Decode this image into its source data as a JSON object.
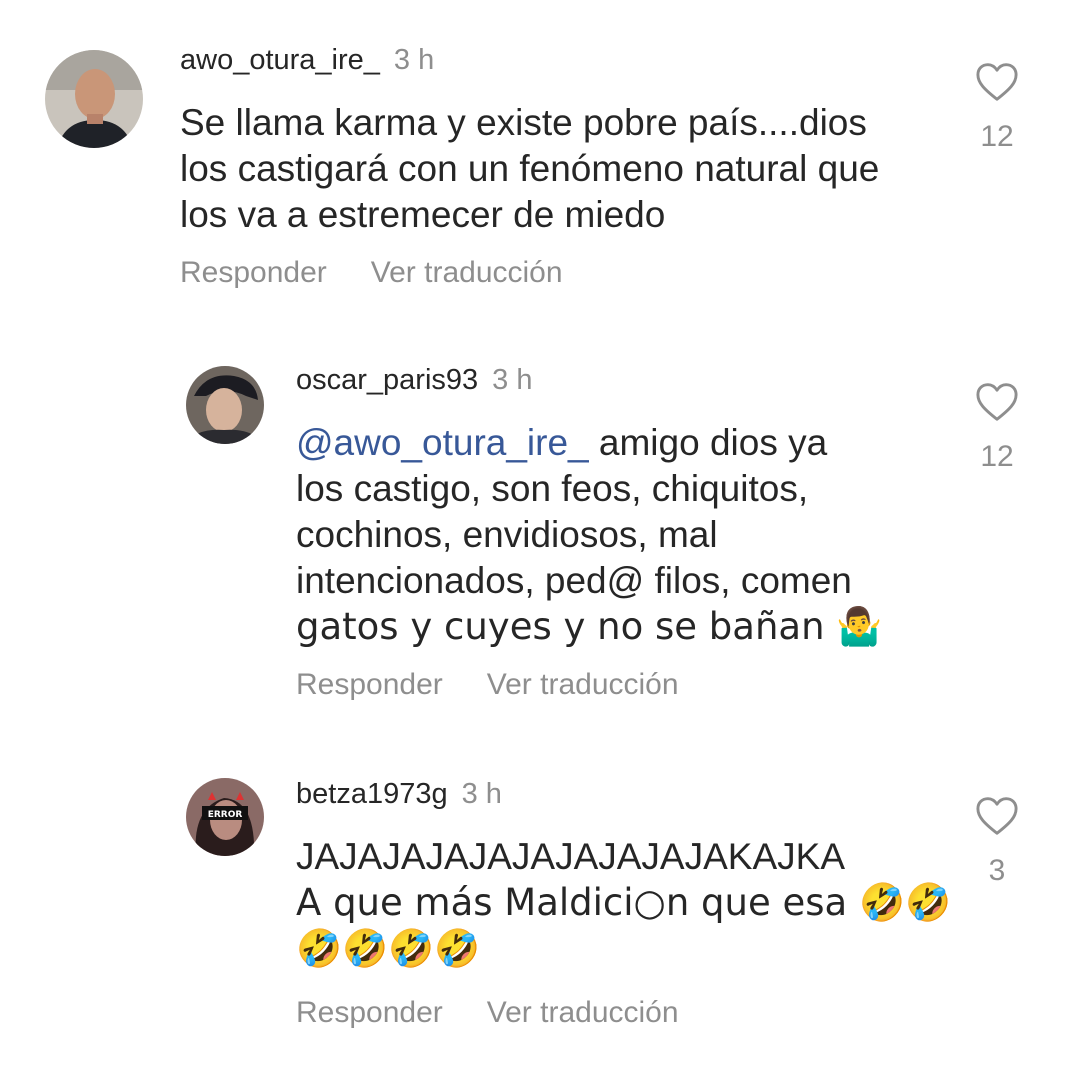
{
  "comments": [
    {
      "username": "awo_otura_ire_",
      "time": "3 h",
      "lines": [
        "Se llama karma y existe pobre país....dios",
        "los castigará con un fenómeno natural que",
        "los va a estremecer de miedo"
      ],
      "likes": "12",
      "reply": "Responder",
      "translate": "Ver traducción",
      "avatar_icon": "man-avatar"
    },
    {
      "username": "oscar_paris93",
      "time": "3 h",
      "mention": "@awo_otura_ire_",
      "line1_rest": " amigo dios ya",
      "lines": [
        "los castigo, son feos, chiquitos,",
        "cochinos, envidiosos, mal",
        "intencionados, ped@ filos, comen",
        "gatos y cuyes y no se bañan 🤷‍♂️"
      ],
      "likes": "12",
      "reply": "Responder",
      "translate": "Ver traducción",
      "avatar_icon": "young-man-avatar"
    },
    {
      "username": "betza1973g",
      "time": "3 h",
      "lines": [
        "JAJAJAJAJAJAJAJAJAJAKAJKA",
        "A que más Maldici○n que esa 🤣🤣",
        "🤣🤣🤣🤣"
      ],
      "likes": "3",
      "reply": "Responder",
      "translate": "Ver traducción",
      "avatar_icon": "error-avatar",
      "avatar_text": "ERROR"
    }
  ],
  "colors": {
    "text": "#262626",
    "muted": "#8e8e8e",
    "mention": "#385898"
  }
}
